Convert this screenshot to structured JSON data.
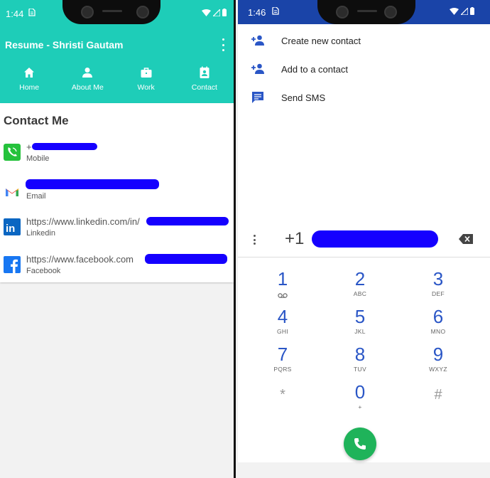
{
  "left": {
    "status": {
      "time": "1:44",
      "sim_icon": "sim-icon"
    },
    "app_title": "Resume - Shristi Gautam",
    "tabs": [
      {
        "label": "Home",
        "icon": "home-icon"
      },
      {
        "label": "About Me",
        "icon": "person-icon"
      },
      {
        "label": "Work",
        "icon": "briefcase-icon"
      },
      {
        "label": "Contact",
        "icon": "contact-card-icon"
      }
    ],
    "header_color": "#1ecdb8",
    "section_title": "Contact Me",
    "contacts": [
      {
        "value": "+",
        "label": "Mobile",
        "icon": "phone-app-icon"
      },
      {
        "value": "",
        "label": "Email",
        "icon": "gmail-icon"
      },
      {
        "value": "https://www.linkedin.com/in/",
        "label": "Linkedin",
        "icon": "linkedin-icon"
      },
      {
        "value": "https://www.facebook.com",
        "label": "Facebook",
        "icon": "facebook-icon"
      }
    ]
  },
  "right": {
    "status": {
      "time": "1:46",
      "sim_icon": "sim-icon"
    },
    "status_color": "#1a44a8",
    "menu": [
      {
        "label": "Create new contact",
        "icon": "add-person-icon"
      },
      {
        "label": "Add to a contact",
        "icon": "add-person-icon"
      },
      {
        "label": "Send SMS",
        "icon": "message-icon"
      }
    ],
    "number": "+1",
    "keys": [
      {
        "digit": "1",
        "letters": ""
      },
      {
        "digit": "2",
        "letters": "ABC"
      },
      {
        "digit": "3",
        "letters": "DEF"
      },
      {
        "digit": "4",
        "letters": "GHI"
      },
      {
        "digit": "5",
        "letters": "JKL"
      },
      {
        "digit": "6",
        "letters": "MNO"
      },
      {
        "digit": "7",
        "letters": "PQRS"
      },
      {
        "digit": "8",
        "letters": "TUV"
      },
      {
        "digit": "9",
        "letters": "WXYZ"
      },
      {
        "digit": "*",
        "letters": ""
      },
      {
        "digit": "0",
        "letters": "+"
      },
      {
        "digit": "#",
        "letters": ""
      }
    ],
    "call_color": "#1fb35a"
  }
}
